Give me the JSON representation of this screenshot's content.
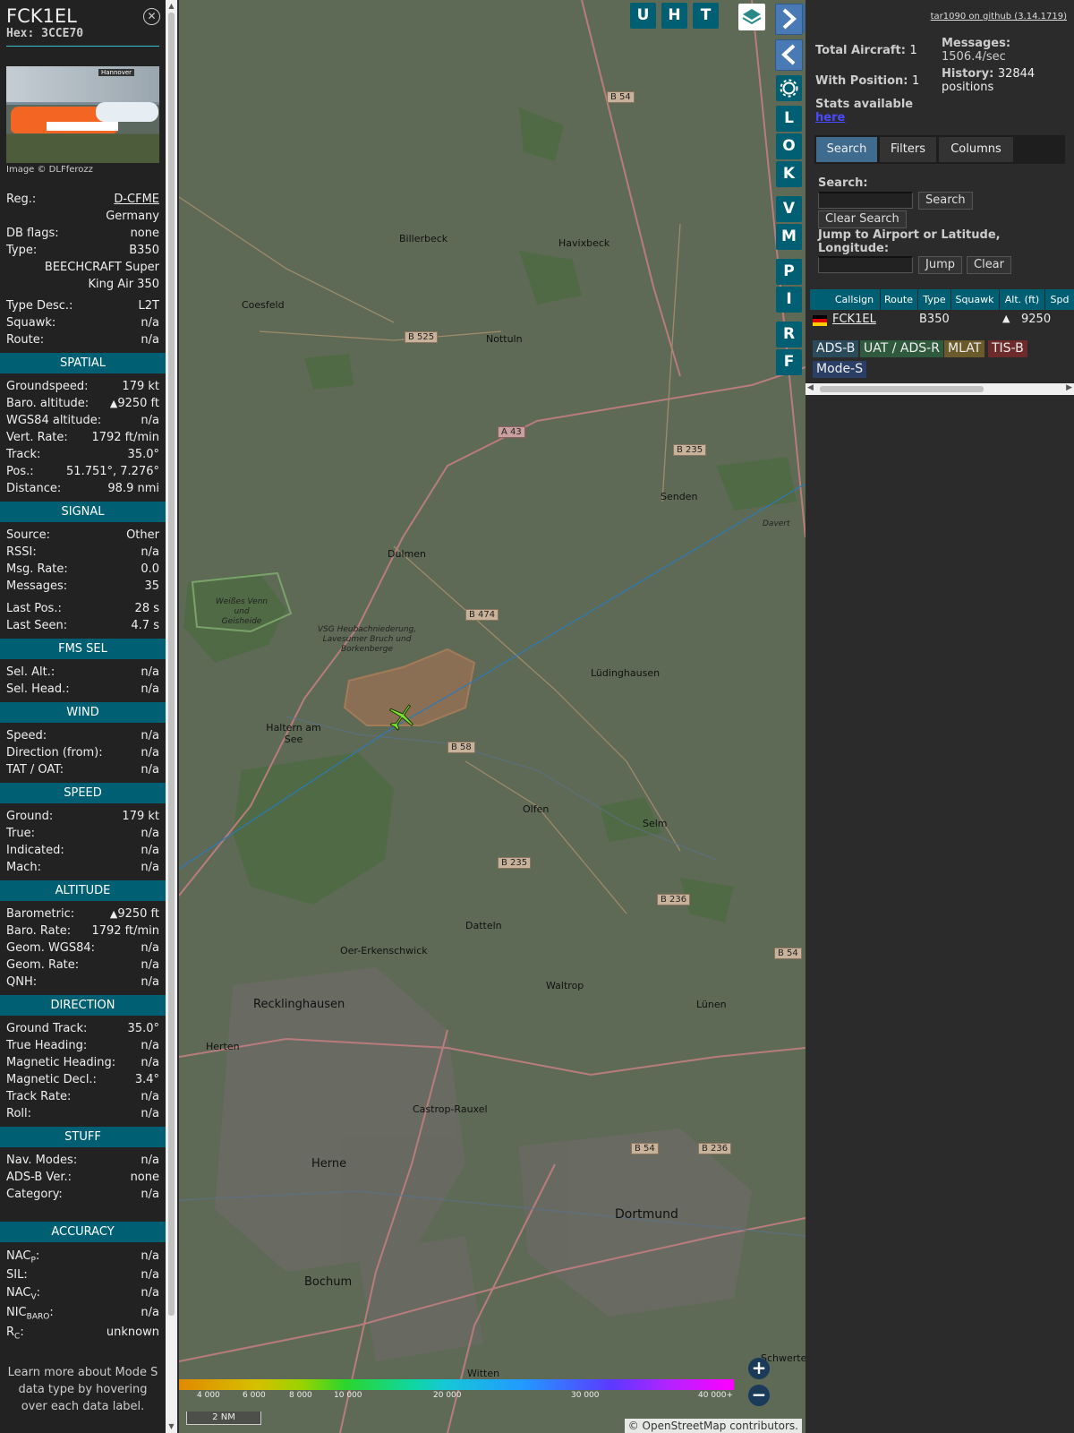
{
  "infoblock": {
    "callsign": "FCK1EL",
    "hex_label": "Hex:",
    "hex": "3CCE70",
    "close_icon": "close-icon",
    "photo_sign": "Hannover",
    "photo_credit": "Image © DLFferozz",
    "reg_label": "Reg.:",
    "reg": "D-CFME",
    "country": "Germany",
    "dbflags_label": "DB flags:",
    "dbflags": "none",
    "type_label": "Type:",
    "type": "B350",
    "type_full": "BEECHCRAFT Super King Air 350",
    "typedesc_label": "Type Desc.:",
    "typedesc": "L2T",
    "squawk_label": "Squawk:",
    "squawk": "n/a",
    "route_label": "Route:",
    "route": "n/a",
    "spatial": {
      "title": "SPATIAL",
      "gs_label": "Groundspeed:",
      "gs": "179 kt",
      "baro_label": "Baro. altitude:",
      "baro_arrow": "▲",
      "baro": "9250 ft",
      "wgs_label": "WGS84 altitude:",
      "wgs": "n/a",
      "vr_label": "Vert. Rate:",
      "vr": "1792 ft/min",
      "track_label": "Track:",
      "track": "35.0°",
      "pos_label": "Pos.:",
      "pos": "51.751°, 7.276°",
      "dist_label": "Distance:",
      "dist": "98.9 nmi"
    },
    "signal": {
      "title": "SIGNAL",
      "source_label": "Source:",
      "source": "Other",
      "rssi_label": "RSSI:",
      "rssi": "n/a",
      "msgrate_label": "Msg. Rate:",
      "msgrate": "0.0",
      "messages_label": "Messages:",
      "messages": "35",
      "lastpos_label": "Last Pos.:",
      "lastpos": "28 s",
      "lastseen_label": "Last Seen:",
      "lastseen": "4.7 s"
    },
    "fms": {
      "title": "FMS SEL",
      "selalt_label": "Sel. Alt.:",
      "selalt": "n/a",
      "selhead_label": "Sel. Head.:",
      "selhead": "n/a"
    },
    "wind": {
      "title": "WIND",
      "speed_label": "Speed:",
      "speed": "n/a",
      "dir_label": "Direction (from):",
      "dir": "n/a",
      "tat_label": "TAT / OAT:",
      "tat": "n/a"
    },
    "speed": {
      "title": "SPEED",
      "ground_label": "Ground:",
      "ground": "179 kt",
      "true_label": "True:",
      "true": "n/a",
      "ind_label": "Indicated:",
      "ind": "n/a",
      "mach_label": "Mach:",
      "mach": "n/a"
    },
    "altitude": {
      "title": "ALTITUDE",
      "baro_label": "Barometric:",
      "baro_arrow": "▲",
      "baro": "9250 ft",
      "barorate_label": "Baro. Rate:",
      "barorate": "1792 ft/min",
      "geom_label": "Geom. WGS84:",
      "geom": "n/a",
      "geomrate_label": "Geom. Rate:",
      "geomrate": "n/a",
      "qnh_label": "QNH:",
      "qnh": "n/a"
    },
    "direction": {
      "title": "DIRECTION",
      "gtrack_label": "Ground Track:",
      "gtrack": "35.0°",
      "theading_label": "True Heading:",
      "theading": "n/a",
      "mheading_label": "Magnetic Heading:",
      "mheading": "n/a",
      "mdecl_label": "Magnetic Decl.:",
      "mdecl": "3.4°",
      "trackrate_label": "Track Rate:",
      "trackrate": "n/a",
      "roll_label": "Roll:",
      "roll": "n/a"
    },
    "stuff": {
      "title": "STUFF",
      "navmodes_label": "Nav. Modes:",
      "navmodes": "n/a",
      "adsbver_label": "ADS-B Ver.:",
      "adsbver": "none",
      "category_label": "Category:",
      "category": "n/a"
    },
    "accuracy": {
      "title": "ACCURACY",
      "nacp_label": "NAC",
      "nacp_sub": "P",
      "nacp": "n/a",
      "sil_label": "SIL:",
      "sil": "n/a",
      "nacv_label": "NAC",
      "nacv_sub": "V",
      "nacv": "n/a",
      "nicbaro_label": "NIC",
      "nicbaro_sub": "BARO",
      "nicbaro": "n/a",
      "rc_label": "R",
      "rc_sub": "C",
      "rc": "unknown"
    },
    "learn_more": "Learn more about Mode S data type by hovering over each data label."
  },
  "map": {
    "top_buttons": [
      "U",
      "H",
      "T"
    ],
    "layers_icon": "layers-icon",
    "side_buttons": [
      "L",
      "O",
      "K",
      "V",
      "M",
      "P",
      "I",
      "R",
      "F"
    ],
    "settings_icon": "gear-icon",
    "zoom_in": "+",
    "zoom_out": "−",
    "alt_ticks": [
      "4 000",
      "6 000",
      "8 000",
      "10 000",
      "20 000",
      "30 000",
      "40 000+"
    ],
    "scale": "2 NM",
    "attribution_c": "©",
    "attribution_link": "OpenStreetMap",
    "attribution_text": "contributors.",
    "places": [
      "Billerbeck",
      "Havixbeck",
      "Coesfeld",
      "Nottuln",
      "Senden",
      "Dulmen",
      "Lüdinghausen",
      "Haltern am See",
      "Olfen",
      "Selm",
      "Datteln",
      "Oer-Erkenschwick",
      "Waltrop",
      "Recklinghausen",
      "Lünen",
      "Herten",
      "Castrop-Rauxel",
      "Herne",
      "Dortmund",
      "Bochum",
      "Witten",
      "Schwerte",
      "Davert"
    ],
    "area_labels": [
      "Weißes Venn und Geisheide",
      "VSG Heubachniederung, Lavesumer Bruch und Borkenberge"
    ],
    "road_labels": [
      "B 54",
      "B 525",
      "A 43",
      "B 235",
      "B 474",
      "B 58",
      "B 235",
      "B 236",
      "B 54",
      "B 54",
      "B 236"
    ],
    "aircraft": "FCK1EL"
  },
  "sidebar": {
    "github_link": "tar1090 on github (3.14.1719)",
    "total_aircraft_label": "Total Aircraft:",
    "total_aircraft": "1",
    "with_position_label": "With Position:",
    "with_position": "1",
    "messages_label": "Messages:",
    "messages_rate": "1506.4/sec",
    "history_label": "History:",
    "history": "32844 positions",
    "stats_text": "Stats available",
    "stats_link": "here",
    "tabs": [
      "Search",
      "Filters",
      "Columns"
    ],
    "search_label": "Search:",
    "search_button": "Search",
    "clear_search_button": "Clear Search",
    "jump_label": "Jump to Airport or Latitude, Longitude:",
    "jump_button": "Jump",
    "clear_button": "Clear",
    "table_headers": [
      "Callsign",
      "Route",
      "Type",
      "Squawk",
      "Alt. (ft)",
      "Spd"
    ],
    "row": {
      "flag": "flag-germany-icon",
      "callsign": "FCK1EL",
      "route": "",
      "type": "B350",
      "squawk": "",
      "alt_arrow": "▲",
      "alt": "9250"
    },
    "sources": [
      {
        "label": "ADS-B",
        "color": "#2b4b5c"
      },
      {
        "label": "UAT / ADS-R",
        "color": "#2f5a3e"
      },
      {
        "label": "MLAT",
        "color": "#6b5a2a"
      },
      {
        "label": "TIS-B",
        "color": "#6e2b2b"
      },
      {
        "label": "Mode-S",
        "color": "#2b3f66"
      }
    ]
  }
}
